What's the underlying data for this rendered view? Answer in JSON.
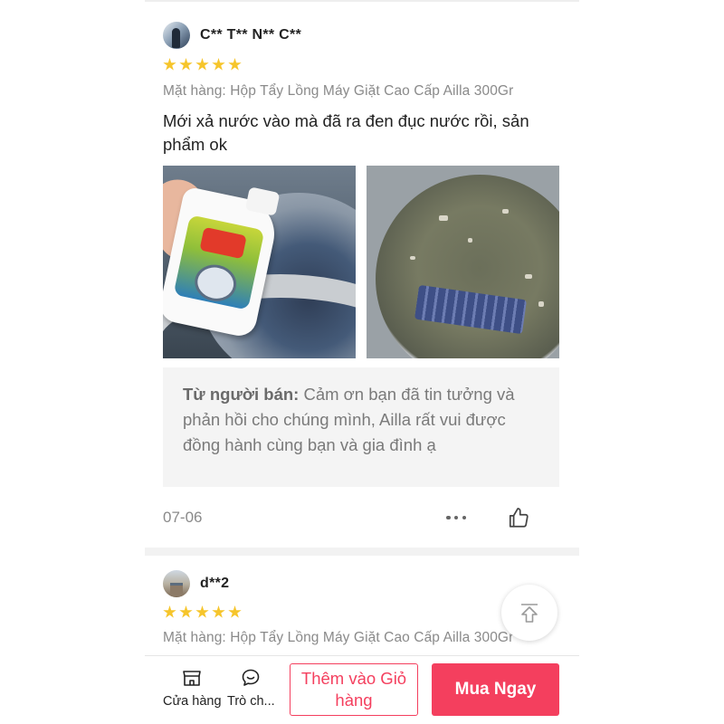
{
  "reviews": [
    {
      "username": "C** T** N** C**",
      "rating": 5,
      "variant": "Mặt hàng: Hộp Tẩy Lồng Máy Giặt Cao Cấp Ailla 300Gr",
      "text": "Mới xả nước vào mà đã ra đen đục nước rồi, sản phẩm ok",
      "photos": [
        "product-bottle-in-washer-photo",
        "dirty-washer-tub-photo"
      ],
      "seller_reply": {
        "label": "Từ người bán:",
        "text": "Cảm ơn bạn đã tin tưởng và phản hồi cho chúng mình, Ailla rất vui được đồng hành cùng bạn và gia đình ạ"
      },
      "date": "07-06"
    },
    {
      "username": "d**2",
      "rating": 5,
      "variant": "Mặt hàng: Hộp Tẩy Lồng Máy Giặt Cao Cấp Ailla 300Gr"
    }
  ],
  "bottom_bar": {
    "shop_label": "Cửa hàng",
    "chat_label": "Trò ch...",
    "add_to_cart_label": "Thêm vào Giỏ hàng",
    "buy_now_label": "Mua Ngay"
  },
  "colors": {
    "accent": "#f43f5e",
    "star": "#f6c52b"
  },
  "icons": [
    "more-icon",
    "thumbs-up-icon",
    "scroll-to-top-icon",
    "shop-icon",
    "chat-icon"
  ]
}
